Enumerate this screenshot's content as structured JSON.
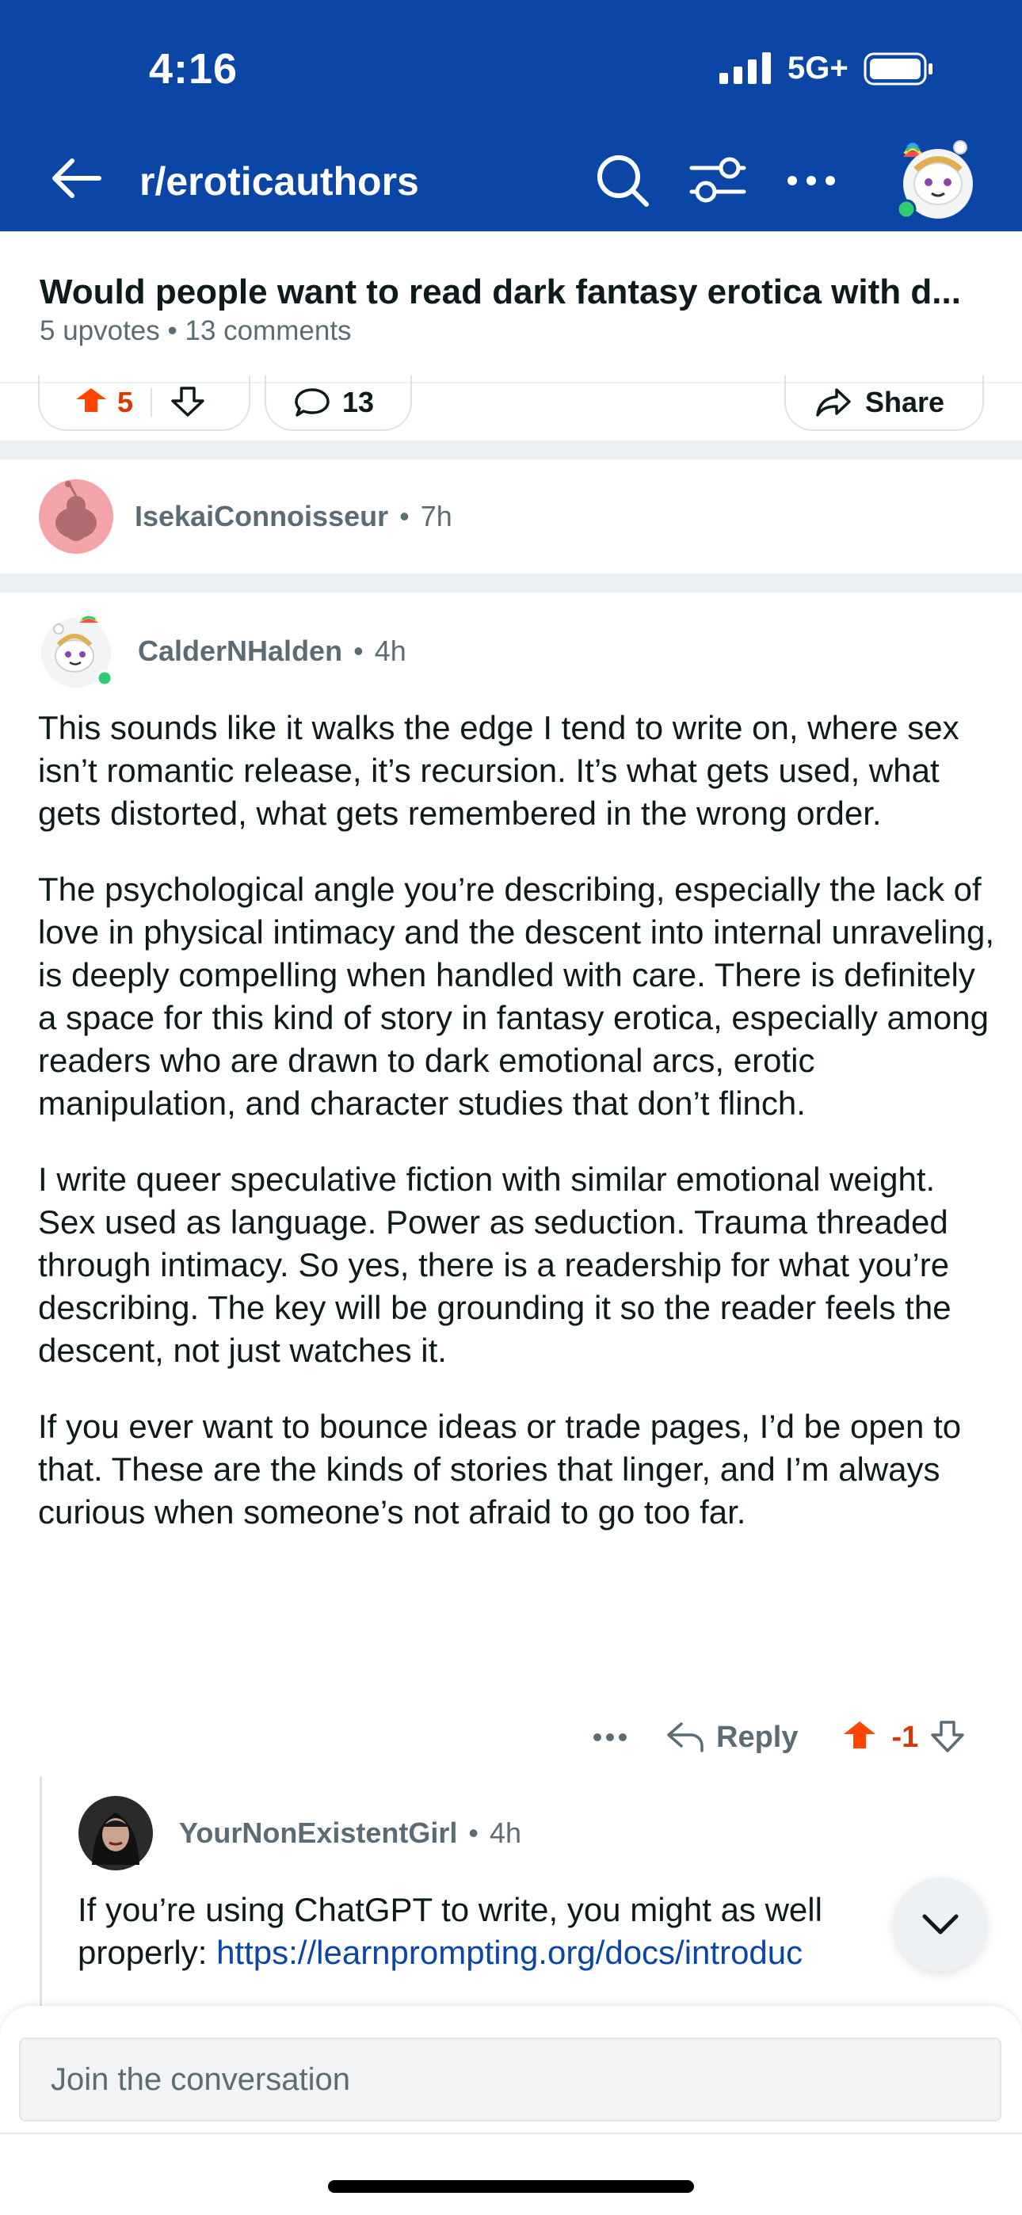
{
  "status_bar": {
    "time": "4:16",
    "network": "5G+"
  },
  "header": {
    "back_icon": "arrow-left-icon",
    "subreddit": "r/eroticauthors",
    "icons": [
      "search-icon",
      "filter-icon",
      "more-icon"
    ]
  },
  "post": {
    "title": "Would people want to read dark fantasy erotica with d...",
    "meta": "5 upvotes • 13 comments",
    "vote_count": "5",
    "comment_count": "13",
    "share_label": "Share"
  },
  "collapsed_comment": {
    "author": "IsekaiConnoisseur",
    "time": "7h"
  },
  "comment": {
    "author": "CalderNHalden",
    "time": "4h",
    "paragraphs": [
      "This sounds like it walks the edge I tend to write on, where sex isn’t romantic release, it’s recursion. It’s what gets used, what gets distorted, what gets remembered in the wrong order.",
      "The psychological angle you’re describing, especially the lack of love in physical intimacy and the descent into internal unraveling, is deeply compelling when handled with care. There is definitely a space for this kind of story in fantasy erotica, especially among readers who are drawn to dark emotional arcs, erotic manipulation, and character studies that don’t flinch.",
      "I write queer speculative fiction with similar emotional weight. Sex used as language. Power as seduction. Trauma threaded through intimacy. So yes, there is a readership for what you’re describing. The key will be grounding it so the reader feels the descent, not just watches it.",
      "If you ever want to bounce ideas or trade pages, I’d be open to that. These are the kinds of stories that linger, and I’m always curious when someone’s not afraid to go too far."
    ],
    "reply_label": "Reply",
    "score": "-1"
  },
  "reply": {
    "author": "YourNonExistentGirl",
    "time": "4h",
    "text_line1": "If you’re using ChatGPT to write, you might as well",
    "text_line2_prefix": "properly:",
    "link": "https://learnprompting.org/docs/introduc"
  },
  "composer": {
    "placeholder": "Join the conversation"
  },
  "colors": {
    "header_bg": "#0b45a6",
    "upvote": "#ff4500",
    "score": "#d93900",
    "link": "#0b45a6",
    "meta": "#5c6c74"
  }
}
